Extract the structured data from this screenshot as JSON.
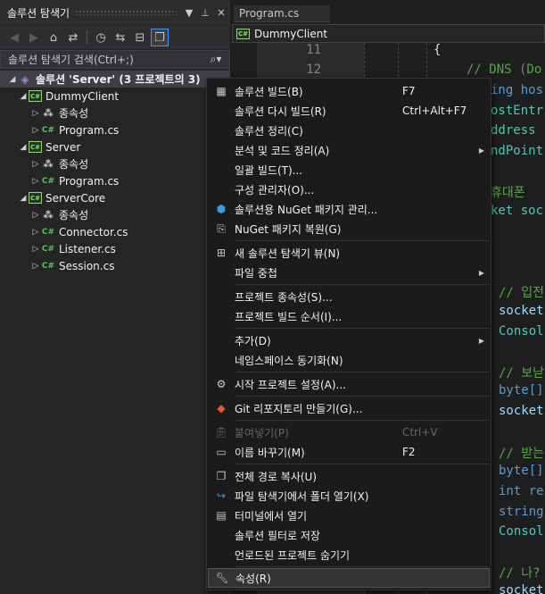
{
  "solution_explorer": {
    "title": "솔루션 탐색기",
    "search_placeholder": "솔루션 탐색기 검색(Ctrl+;)",
    "tree": [
      {
        "label": "솔루션 'Server'  (3 프로젝트의 3)",
        "kind": "solution",
        "expanded": true
      },
      {
        "label": "DummyClient",
        "kind": "project",
        "expanded": true
      },
      {
        "label": "종속성",
        "kind": "dependencies",
        "expanded": false
      },
      {
        "label": "Program.cs",
        "kind": "csfile",
        "expanded": false
      },
      {
        "label": "Server",
        "kind": "project",
        "expanded": true
      },
      {
        "label": "종속성",
        "kind": "dependencies",
        "expanded": false
      },
      {
        "label": "Program.cs",
        "kind": "csfile",
        "expanded": false
      },
      {
        "label": "ServerCore",
        "kind": "project",
        "expanded": true
      },
      {
        "label": "종속성",
        "kind": "dependencies",
        "expanded": false
      },
      {
        "label": "Connector.cs",
        "kind": "csfile",
        "expanded": false
      },
      {
        "label": "Listener.cs",
        "kind": "csfile",
        "expanded": false
      },
      {
        "label": "Session.cs",
        "kind": "csfile",
        "expanded": false
      }
    ]
  },
  "editor": {
    "tab_label": "Program.cs",
    "nav_project": "DummyClient",
    "line_numbers": [
      "11",
      "12"
    ],
    "visible_code": [
      "{",
      "// DNS (Do",
      "ing hos",
      "ostEntr",
      "ddress",
      "ndPoint",
      "휴대폰",
      "ket soc",
      "// 입전",
      "socket",
      "Consol",
      "// 보낟",
      "byte[]",
      "socket",
      "// 받는",
      "byte[]",
      "int re",
      "string",
      "Consol",
      "// 나?",
      "socket"
    ]
  },
  "context_menu": {
    "items": [
      {
        "label": "솔루션 빌드(B)",
        "shortcut": "F7",
        "icon": "build-solution-icon",
        "submenu": false,
        "disabled": false
      },
      {
        "label": "솔루션 다시 빌드(R)",
        "shortcut": "Ctrl+Alt+F7",
        "icon": "",
        "submenu": false,
        "disabled": false
      },
      {
        "label": "솔루션 정리(C)",
        "shortcut": "",
        "icon": "",
        "submenu": false,
        "disabled": false
      },
      {
        "label": "분석 및 코드 정리(A)",
        "shortcut": "",
        "icon": "",
        "submenu": true,
        "disabled": false
      },
      {
        "label": "일괄 빌드(T)...",
        "shortcut": "",
        "icon": "",
        "submenu": false,
        "disabled": false
      },
      {
        "label": "구성 관리자(O)...",
        "shortcut": "",
        "icon": "",
        "submenu": false,
        "disabled": false
      },
      {
        "label": "솔루션용 NuGet 패키지 관리...",
        "shortcut": "",
        "icon": "nuget-icon",
        "submenu": false,
        "disabled": false
      },
      {
        "label": "NuGet 패키지 복원(G)",
        "shortcut": "",
        "icon": "package-restore-icon",
        "submenu": false,
        "disabled": false
      },
      {
        "label": "새 솔루션 탐색기 뷰(N)",
        "shortcut": "",
        "icon": "new-view-icon",
        "submenu": false,
        "disabled": false
      },
      {
        "label": "파일 중첩",
        "shortcut": "",
        "icon": "",
        "submenu": true,
        "disabled": false
      },
      {
        "label": "프로젝트 종속성(S)...",
        "shortcut": "",
        "icon": "",
        "submenu": false,
        "disabled": false
      },
      {
        "label": "프로젝트 빌드 순서(I)...",
        "shortcut": "",
        "icon": "",
        "submenu": false,
        "disabled": false
      },
      {
        "label": "추가(D)",
        "shortcut": "",
        "icon": "",
        "submenu": true,
        "disabled": false
      },
      {
        "label": "네임스페이스 동기화(N)",
        "shortcut": "",
        "icon": "",
        "submenu": false,
        "disabled": false
      },
      {
        "label": "시작 프로젝트 설정(A)...",
        "shortcut": "",
        "icon": "gear-icon",
        "submenu": false,
        "disabled": false
      },
      {
        "label": "Git 리포지토리 만들기(G)...",
        "shortcut": "",
        "icon": "git-icon",
        "submenu": false,
        "disabled": false
      },
      {
        "label": "붙여넣기(P)",
        "shortcut": "Ctrl+V",
        "icon": "paste-icon",
        "submenu": false,
        "disabled": true
      },
      {
        "label": "이름 바꾸기(M)",
        "shortcut": "F2",
        "icon": "rename-icon",
        "submenu": false,
        "disabled": false
      },
      {
        "label": "전체 경로 복사(U)",
        "shortcut": "",
        "icon": "copy-icon",
        "submenu": false,
        "disabled": false
      },
      {
        "label": "파일 탐색기에서 폴더 열기(X)",
        "shortcut": "",
        "icon": "open-folder-icon",
        "submenu": false,
        "disabled": false
      },
      {
        "label": "터미널에서 열기",
        "shortcut": "",
        "icon": "terminal-icon",
        "submenu": false,
        "disabled": false
      },
      {
        "label": "솔루션 필터로 저장",
        "shortcut": "",
        "icon": "",
        "submenu": false,
        "disabled": false
      },
      {
        "label": "언로드된 프로젝트 숨기기",
        "shortcut": "",
        "icon": "",
        "submenu": false,
        "disabled": false
      },
      {
        "label": "속성(R)",
        "shortcut": "",
        "icon": "wrench-icon",
        "submenu": false,
        "disabled": false
      }
    ]
  },
  "colors": {
    "background": "#1e1e1e",
    "panel": "#252526",
    "menu": "#1b1b1c",
    "csharp_green": "#9ad27c",
    "comment_green": "#57a64a",
    "keyword_blue": "#569cd6"
  }
}
